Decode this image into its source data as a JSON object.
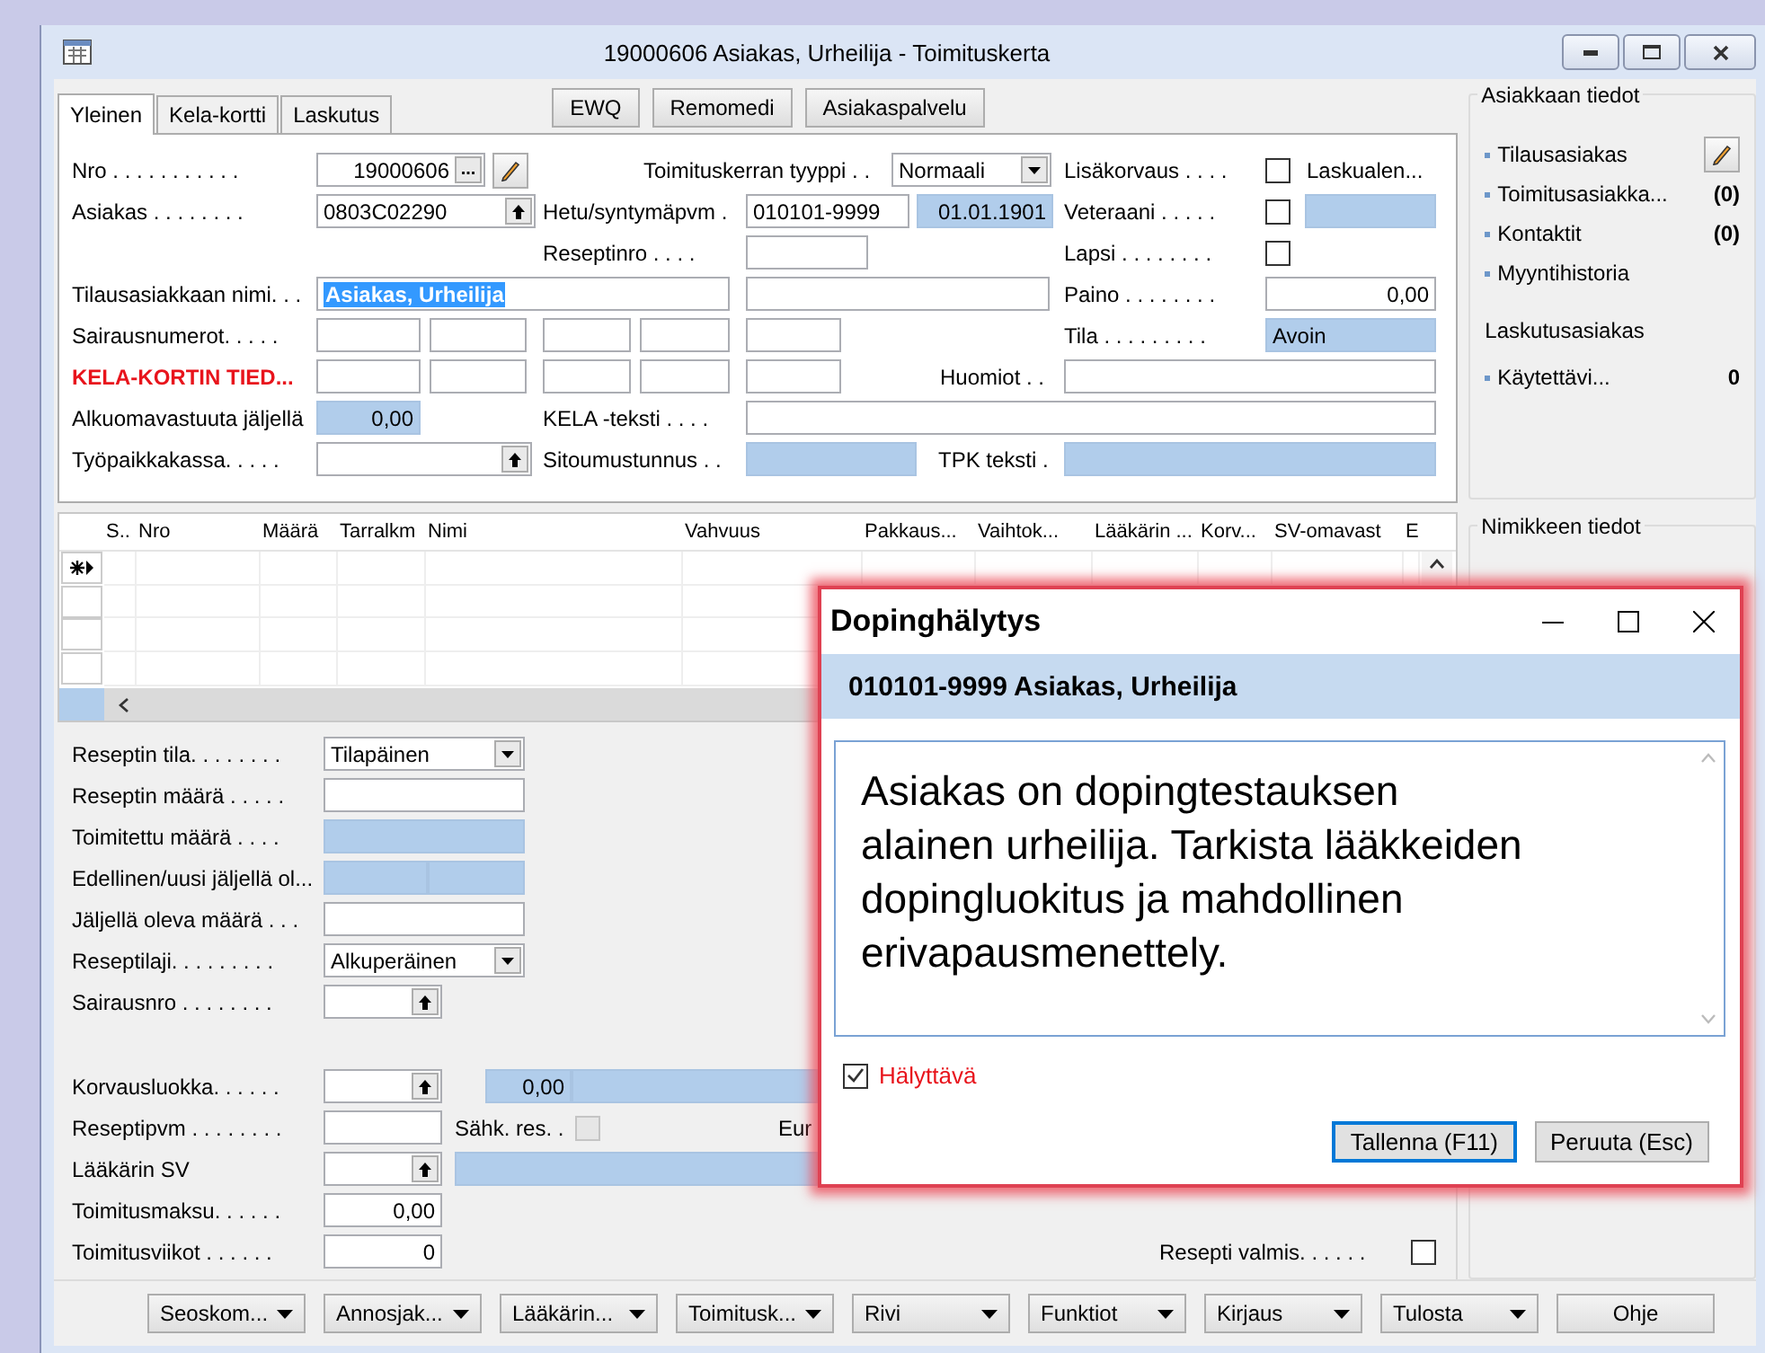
{
  "window": {
    "title": "19000606 Asiakas, Urheilija - Toimituskerta"
  },
  "tabs": [
    {
      "label": "Yleinen",
      "selected": true
    },
    {
      "label": "Kela-kortti",
      "selected": false
    },
    {
      "label": "Laskutus",
      "selected": false
    }
  ],
  "toolbar_buttons": [
    "EWQ",
    "Remomedi",
    "Asiakaspalvelu"
  ],
  "form": {
    "rows": [
      {
        "items": [
          {
            "kind": "label",
            "text": "Nro . . . . . . . . . . ."
          },
          {
            "kind": "browse",
            "value": "19000606",
            "button": "..."
          },
          {
            "kind": "pencil"
          },
          {
            "kind": "label",
            "text": "Toimituskerran tyyppi . ."
          },
          {
            "kind": "select",
            "value": "Normaali"
          },
          {
            "kind": "label",
            "text": "Lisäkorvaus . . . ."
          },
          {
            "kind": "checkbox",
            "checked": false,
            "disabled": false
          },
          {
            "kind": "label",
            "text": "Laskualen..."
          }
        ]
      },
      {
        "items": [
          {
            "kind": "label",
            "text": "Asiakas . . . . . . . ."
          },
          {
            "kind": "lookup",
            "value": "0803C02290"
          },
          {
            "kind": "label",
            "text": "Hetu/syntymäpvm ."
          },
          {
            "kind": "field",
            "value": "010101-9999",
            "readonly": false
          },
          {
            "kind": "field",
            "value": "01.01.1901",
            "readonly": true
          },
          {
            "kind": "label",
            "text": "Veteraani . . . . ."
          },
          {
            "kind": "checkbox",
            "checked": false,
            "disabled": false
          },
          {
            "kind": "field",
            "readonly": true
          }
        ]
      },
      {
        "items": [
          {
            "kind": "label",
            "text": "Reseptinro . . . ."
          },
          {
            "kind": "field",
            "readonly": false
          },
          {
            "kind": "label",
            "text": "Lapsi . . . . . . . ."
          },
          {
            "kind": "checkbox",
            "checked": false,
            "disabled": false
          }
        ]
      },
      {
        "items": [
          {
            "kind": "label",
            "text": "Tilausasiakkaan nimi. . ."
          },
          {
            "kind": "selected_text_field",
            "value": "Asiakas, Urheilija"
          },
          {
            "kind": "field",
            "readonly": false
          },
          {
            "kind": "label",
            "text": "Paino . . . . . . . ."
          },
          {
            "kind": "field",
            "value": "0,00",
            "readonly": false
          }
        ]
      },
      {
        "items": [
          {
            "kind": "label",
            "text": "Sairausnumerot. . . . ."
          },
          {
            "kind": "field",
            "readonly": false
          },
          {
            "kind": "field",
            "readonly": false
          },
          {
            "kind": "field",
            "readonly": false
          },
          {
            "kind": "field",
            "readonly": false
          },
          {
            "kind": "field",
            "readonly": false
          },
          {
            "kind": "label",
            "text": "Tila . . . . . . . . ."
          },
          {
            "kind": "field",
            "value": "Avoin",
            "readonly": true
          }
        ]
      },
      {
        "items": [
          {
            "kind": "warning_label",
            "text": "KELA-KORTIN TIED..."
          },
          {
            "kind": "field",
            "readonly": false
          },
          {
            "kind": "field",
            "readonly": false
          },
          {
            "kind": "field",
            "readonly": false
          },
          {
            "kind": "field",
            "readonly": false
          },
          {
            "kind": "field",
            "readonly": false
          },
          {
            "kind": "label",
            "text": "Huomiot . ."
          },
          {
            "kind": "field",
            "readonly": false
          }
        ]
      },
      {
        "items": [
          {
            "kind": "label",
            "text": "Alkuomavastuuta jäljellä"
          },
          {
            "kind": "field",
            "value": "0,00",
            "readonly": true
          },
          {
            "kind": "label",
            "text": "KELA -teksti . . . ."
          },
          {
            "kind": "field",
            "readonly": false
          }
        ]
      },
      {
        "items": [
          {
            "kind": "label",
            "text": "Työpaikkakassa. . . . ."
          },
          {
            "kind": "lookup"
          },
          {
            "kind": "label",
            "text": "Sitoumustunnus . ."
          },
          {
            "kind": "field",
            "readonly": true
          },
          {
            "kind": "label",
            "text": "TPK teksti ."
          },
          {
            "kind": "field",
            "readonly": true
          }
        ]
      }
    ]
  },
  "grid": {
    "columns": [
      "S..",
      "Nro",
      "Määrä",
      "Tarralkm",
      "Nimi",
      "Vahvuus",
      "Pakkaus...",
      "Vaihtok...",
      "Lääkärin ...",
      "Korv...",
      "SV-omavast",
      "E"
    ],
    "rows": [
      {
        "new_row": true
      },
      {
        "new_row": false
      },
      {
        "new_row": false
      },
      {
        "new_row": false
      }
    ]
  },
  "prescription": {
    "rows": [
      {
        "items": [
          {
            "kind": "label",
            "text": "Reseptin tila. . . . . . . ."
          },
          {
            "kind": "select",
            "value": "Tilapäinen"
          }
        ]
      },
      {
        "items": [
          {
            "kind": "label",
            "text": "Reseptin määrä . . . . ."
          },
          {
            "kind": "field",
            "readonly": false
          }
        ]
      },
      {
        "items": [
          {
            "kind": "label",
            "text": "Toimitettu määrä . . . ."
          },
          {
            "kind": "field",
            "readonly": true
          }
        ]
      },
      {
        "items": [
          {
            "kind": "label",
            "text": "Edellinen/uusi jäljellä ol..."
          },
          {
            "kind": "field",
            "readonly": true
          },
          {
            "kind": "field",
            "readonly": true
          }
        ]
      },
      {
        "items": [
          {
            "kind": "label",
            "text": "Jäljellä oleva määrä . . ."
          },
          {
            "kind": "field",
            "readonly": false
          }
        ]
      },
      {
        "items": [
          {
            "kind": "label",
            "text": "Reseptilaji. . . . . . . . ."
          },
          {
            "kind": "select",
            "value": "Alkuperäinen"
          }
        ]
      },
      {
        "items": [
          {
            "kind": "label",
            "text": "Sairausnro . . . . . . . ."
          },
          {
            "kind": "lookup"
          }
        ]
      },
      {
        "items": [
          {
            "kind": "label",
            "text": "Korvausluokka. . . . . ."
          },
          {
            "kind": "lookup"
          },
          {
            "kind": "field",
            "value": "0,00",
            "readonly": true
          },
          {
            "kind": "field",
            "readonly": true
          }
        ]
      },
      {
        "items": [
          {
            "kind": "label",
            "text": "Reseptipvm . . . . . . . ."
          },
          {
            "kind": "field",
            "readonly": false
          },
          {
            "kind": "label",
            "text": "Sähk. res. ."
          },
          {
            "kind": "checkbox",
            "checked": false,
            "disabled": true
          },
          {
            "kind": "label",
            "text": "Eur"
          }
        ]
      },
      {
        "items": [
          {
            "kind": "label",
            "text": "Lääkärin SV"
          },
          {
            "kind": "lookup"
          },
          {
            "kind": "field",
            "readonly": true
          }
        ]
      },
      {
        "items": [
          {
            "kind": "label",
            "text": "Toimitusmaksu. . . . . ."
          },
          {
            "kind": "field",
            "value": "0,00",
            "readonly": false
          }
        ]
      },
      {
        "items": [
          {
            "kind": "label",
            "text": "Toimitusviikot . . . . . ."
          },
          {
            "kind": "field",
            "value": "0",
            "readonly": false
          },
          {
            "kind": "label",
            "text": "Resepti valmis. . . . . ."
          },
          {
            "kind": "checkbox",
            "checked": false,
            "disabled": false
          }
        ]
      }
    ]
  },
  "customer_info": {
    "title": "Asiakkaan tiedot",
    "links": [
      {
        "label": "Tilausasiakas",
        "edit": true
      },
      {
        "label": "Toimitusasiakka...",
        "count": "(0)",
        "edit": false
      },
      {
        "label": "Kontaktit",
        "count": "(0)",
        "edit": false
      },
      {
        "label": "Myyntihistoria",
        "edit": false
      }
    ],
    "billing_title": "Laskutusasiakas",
    "billing_links": [
      {
        "label": "Käytettävi...",
        "count": "0"
      }
    ]
  },
  "item_info": {
    "title": "Nimikkeen tiedot"
  },
  "bottom_buttons": [
    {
      "label": "Seoskom...",
      "menu": true
    },
    {
      "label": "Annosjak...",
      "menu": true
    },
    {
      "label": "Lääkärin...",
      "menu": true
    },
    {
      "label": "Toimitusk...",
      "menu": true
    },
    {
      "label": "Rivi",
      "menu": true
    },
    {
      "label": "Funktiot",
      "menu": true
    },
    {
      "label": "Kirjaus",
      "menu": true
    },
    {
      "label": "Tulosta",
      "menu": true
    },
    {
      "label": "Ohje",
      "menu": false
    }
  ],
  "dialog": {
    "title": "Dopinghälytys",
    "subject": "010101-9999 Asiakas, Urheilija",
    "message": "Asiakas on dopingtestauksen\nalainen urheilija. Tarkista lääkkeiden\ndopingluokitus ja mahdollinen\nerivapausmenettely.",
    "alert": {
      "label": "Hälyttävä",
      "checked": true
    },
    "buttons": [
      {
        "label": "Tallenna (F11)",
        "focused": true
      },
      {
        "label": "Peruuta (Esc)",
        "focused": false
      }
    ]
  }
}
